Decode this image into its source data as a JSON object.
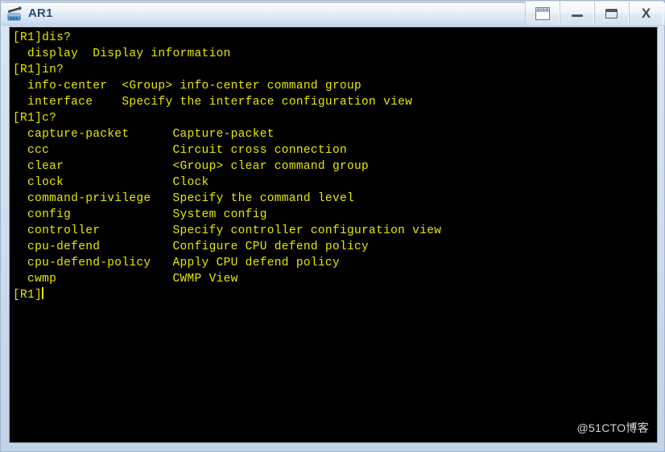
{
  "window": {
    "title": "AR1",
    "app_icon": "router-icon",
    "buttons": [
      {
        "name": "restore-window-button",
        "icon": "window-tile-icon",
        "label": ""
      },
      {
        "name": "minimize-button",
        "icon": "minimize-icon",
        "label": ""
      },
      {
        "name": "maximize-button",
        "icon": "maximize-icon",
        "label": ""
      },
      {
        "name": "close-button",
        "icon": "close-icon",
        "label": "X"
      }
    ]
  },
  "terminal": {
    "foreground_color": "#e8e800",
    "background_color": "#000000",
    "prompt": "[R1]",
    "lines": [
      "[R1]dis?",
      "  display  Display information",
      "[R1]in?",
      "  info-center  <Group> info-center command group",
      "  interface    Specify the interface configuration view",
      "[R1]c?",
      "  capture-packet      Capture-packet",
      "  ccc                 Circuit cross connection",
      "  clear               <Group> clear command group",
      "  clock               Clock",
      "  command-privilege   Specify the command level",
      "  config              System config",
      "  controller          Specify controller configuration view",
      "  cpu-defend          Configure CPU defend policy",
      "  cpu-defend-policy   Apply CPU defend policy",
      "  cwmp                CWMP View"
    ],
    "current_input_line": "[R1]",
    "cursor_visible": true
  },
  "watermark": {
    "text": "@51CTO博客"
  }
}
